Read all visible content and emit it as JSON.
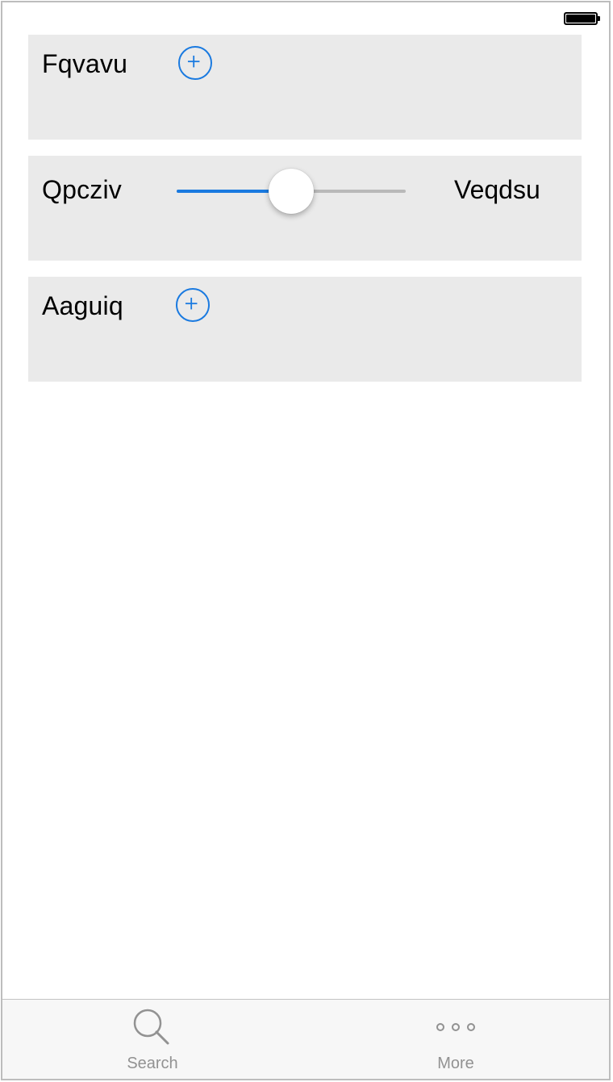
{
  "colors": {
    "accent": "#1a7ae0",
    "row_background": "#eaeaea",
    "tab_inactive": "#929292"
  },
  "rows": [
    {
      "label": "Fqvavu",
      "control": "plus-icon"
    },
    {
      "label": "Qpcziv",
      "control": "slider",
      "slider_value": 0.5,
      "right_label": "Veqdsu"
    },
    {
      "label": "Aaguiq",
      "control": "plus-icon"
    }
  ],
  "tab_bar": {
    "tabs": [
      {
        "label": "Search",
        "icon": "search-icon"
      },
      {
        "label": "More",
        "icon": "more-icon"
      }
    ]
  },
  "status_bar": {
    "battery_level": 1.0
  }
}
